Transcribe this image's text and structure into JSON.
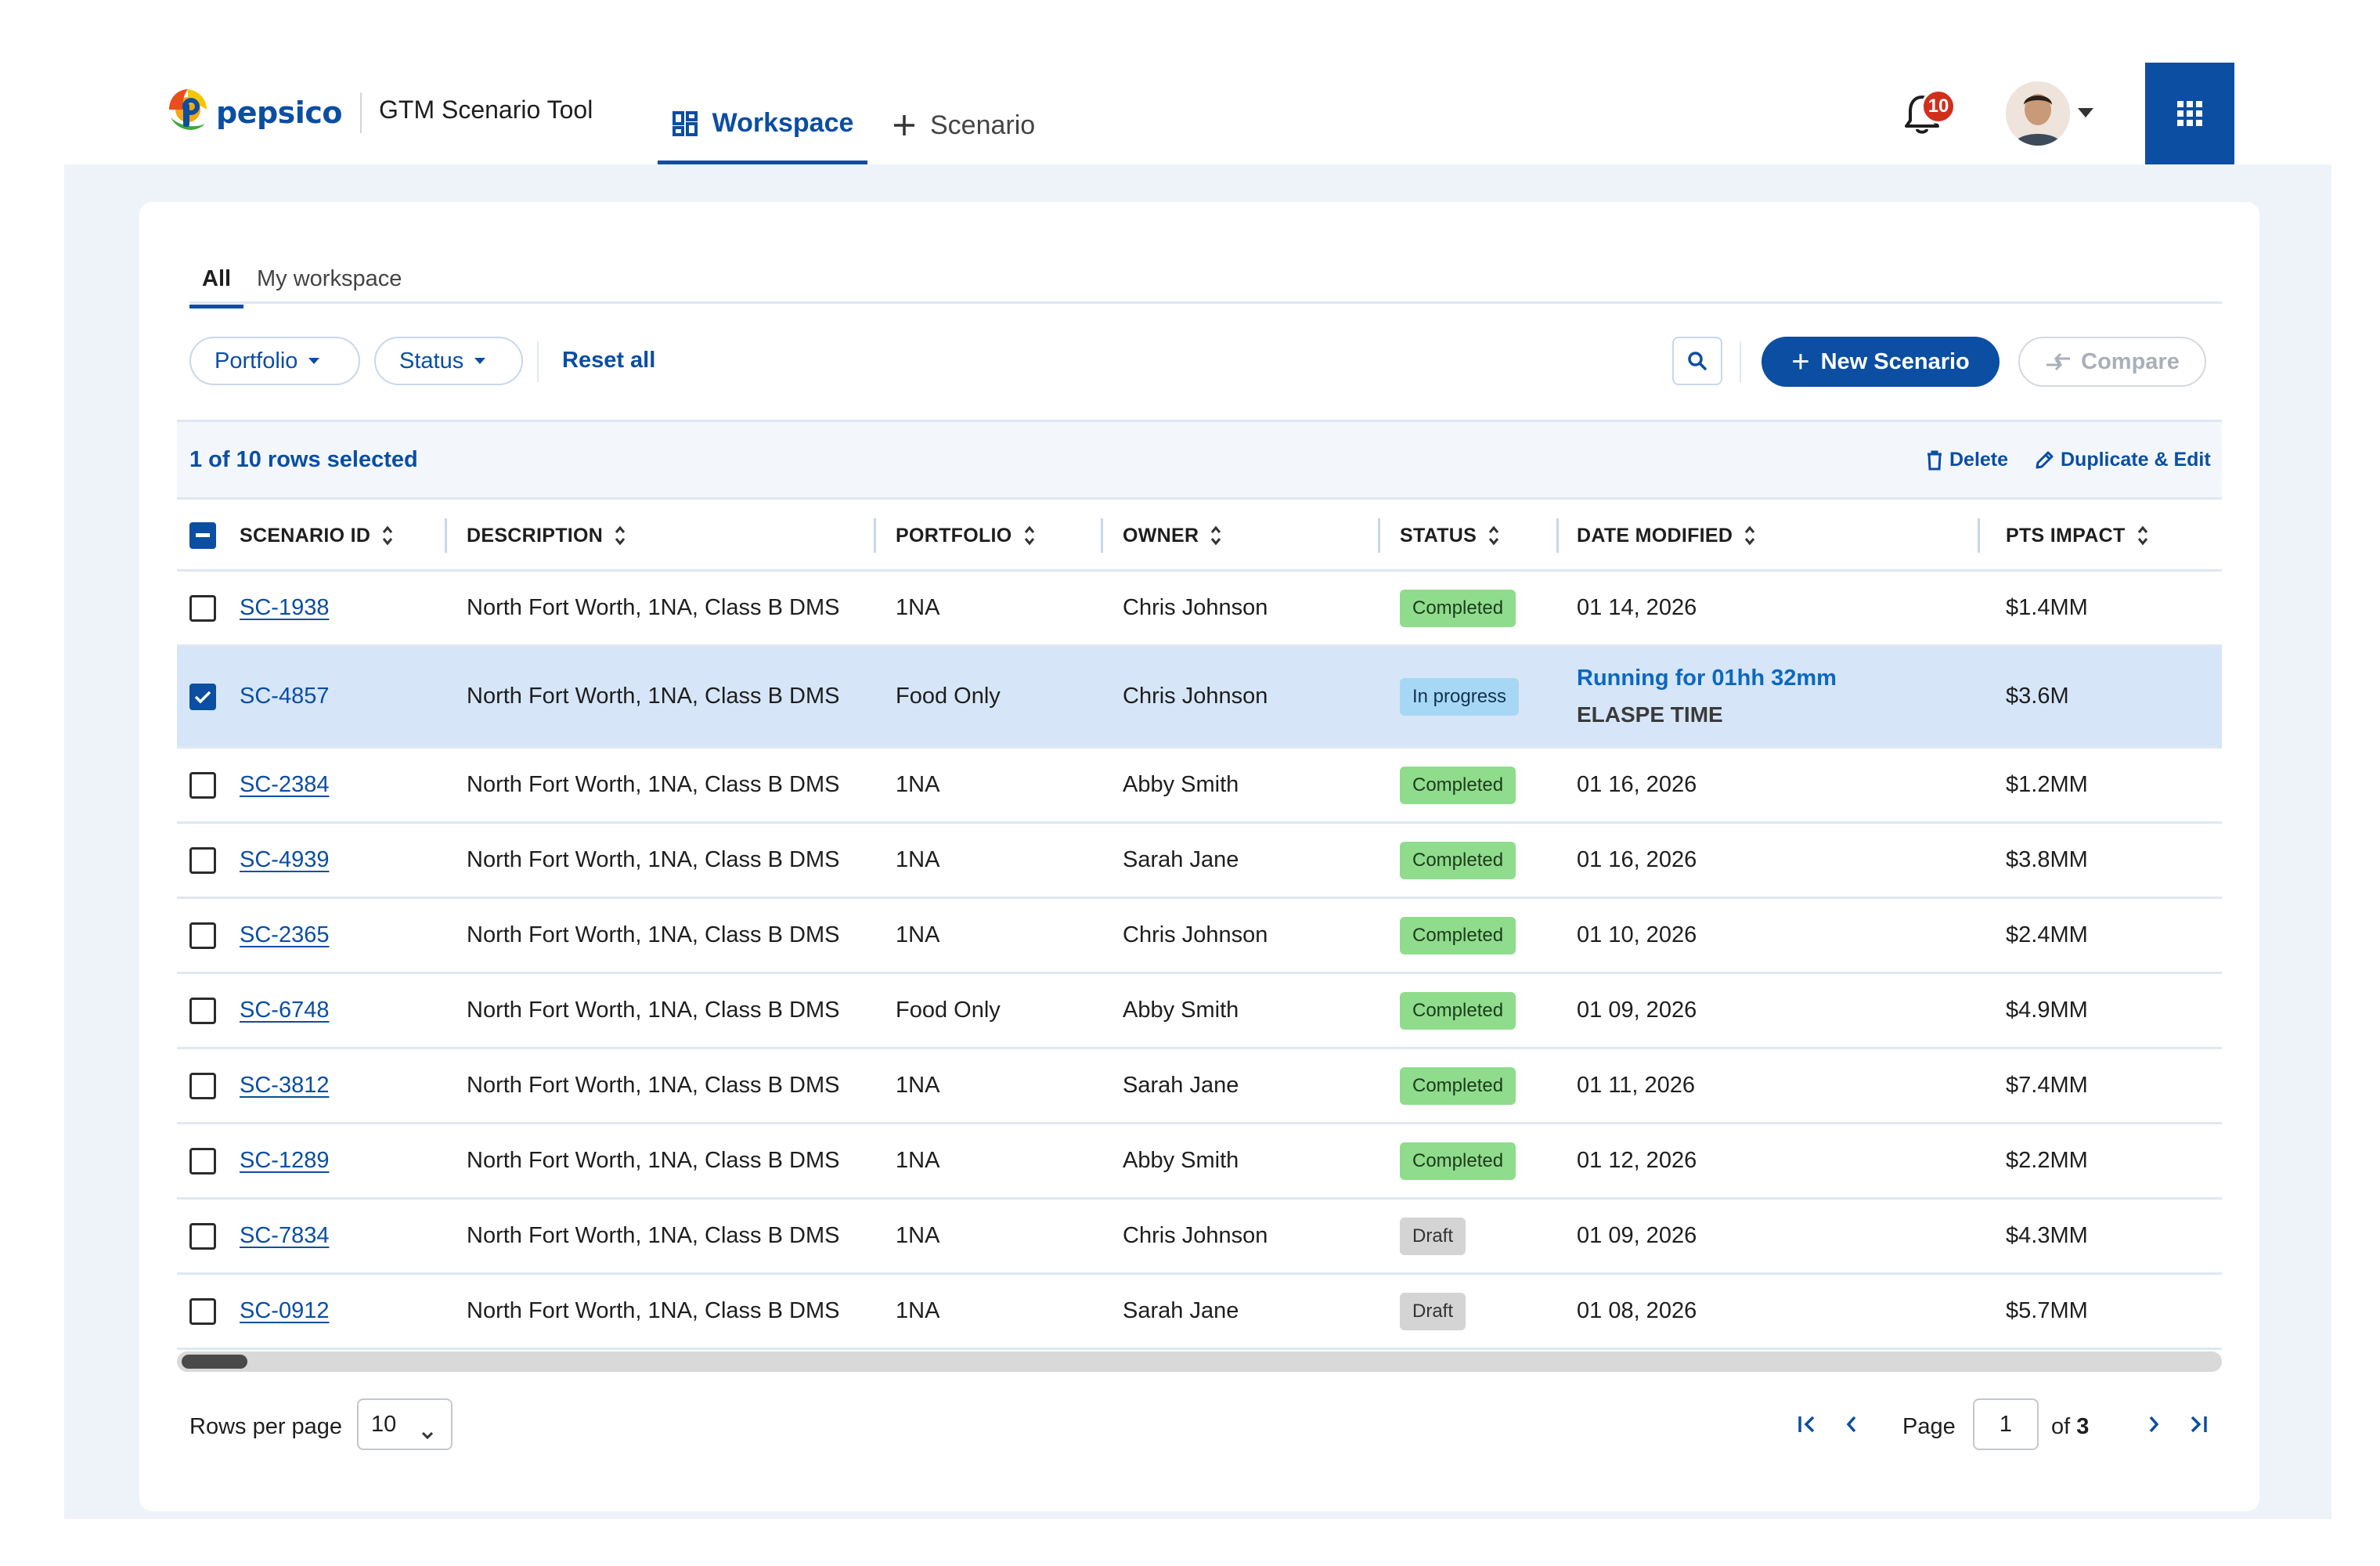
{
  "header": {
    "logo_text": "pepsico",
    "app_name": "GTM Scenario Tool",
    "nav": [
      {
        "label": "Workspace",
        "active": true,
        "icon": "dashboard-icon"
      },
      {
        "label": "Scenario",
        "active": false,
        "icon": "plus-icon"
      }
    ],
    "notifications_count": "10",
    "apps_icon": "grid-apps-icon"
  },
  "subtabs": [
    {
      "label": "All",
      "active": true
    },
    {
      "label": "My workspace",
      "active": false
    }
  ],
  "toolbar": {
    "filters": [
      "Portfolio",
      "Status"
    ],
    "reset_label": "Reset all",
    "new_label": "New Scenario",
    "compare_label": "Compare"
  },
  "selection": {
    "count_text": "1 of 10 rows selected",
    "delete_label": "Delete",
    "duplicate_label": "Duplicate & Edit"
  },
  "table": {
    "columns": [
      "SCENARIO ID",
      "DESCRIPTION",
      "PORTFOLIO",
      "OWNER",
      "STATUS",
      "DATE MODIFIED",
      "PTS IMPACT"
    ],
    "rows": [
      {
        "id": "SC-1938",
        "description": "North Fort Worth, 1NA, Class B DMS",
        "portfolio": "1NA",
        "owner": "Chris Johnson",
        "status": "Completed",
        "date": "01 14, 2026",
        "impact": "$1.4MM",
        "selected": false
      },
      {
        "id": "SC-4857",
        "description": "North Fort Worth, 1NA, Class B DMS",
        "portfolio": "Food Only",
        "owner": "Chris Johnson",
        "status": "In progress",
        "date": "Running for 01hh 32mm",
        "date_sub": "ELASPE TIME",
        "impact": "$3.6M",
        "selected": true
      },
      {
        "id": "SC-2384",
        "description": "North Fort Worth, 1NA, Class B DMS",
        "portfolio": "1NA",
        "owner": "Abby Smith",
        "status": "Completed",
        "date": "01 16, 2026",
        "impact": "$1.2MM",
        "selected": false
      },
      {
        "id": "SC-4939",
        "description": "North Fort Worth, 1NA, Class B DMS",
        "portfolio": "1NA",
        "owner": "Sarah Jane",
        "status": "Completed",
        "date": "01 16, 2026",
        "impact": "$3.8MM",
        "selected": false
      },
      {
        "id": "SC-2365",
        "description": "North Fort Worth, 1NA, Class B DMS",
        "portfolio": "1NA",
        "owner": "Chris Johnson",
        "status": "Completed",
        "date": "01 10, 2026",
        "impact": "$2.4MM",
        "selected": false
      },
      {
        "id": "SC-6748",
        "description": "North Fort Worth, 1NA, Class B DMS",
        "portfolio": "Food Only",
        "owner": "Abby Smith",
        "status": "Completed",
        "date": "01 09, 2026",
        "impact": "$4.9MM",
        "selected": false
      },
      {
        "id": "SC-3812",
        "description": "North Fort Worth, 1NA, Class B DMS",
        "portfolio": "1NA",
        "owner": "Sarah Jane",
        "status": "Completed",
        "date": "01 11, 2026",
        "impact": "$7.4MM",
        "selected": false
      },
      {
        "id": "SC-1289",
        "description": "North Fort Worth, 1NA, Class B DMS",
        "portfolio": "1NA",
        "owner": "Abby Smith",
        "status": "Completed",
        "date": "01 12, 2026",
        "impact": "$2.2MM",
        "selected": false
      },
      {
        "id": "SC-7834",
        "description": "North Fort Worth, 1NA, Class B DMS",
        "portfolio": "1NA",
        "owner": "Chris Johnson",
        "status": "Draft",
        "date": "01 09, 2026",
        "impact": "$4.3MM",
        "selected": false
      },
      {
        "id": "SC-0912",
        "description": "North Fort Worth, 1NA, Class B DMS",
        "portfolio": "1NA",
        "owner": "Sarah Jane",
        "status": "Draft",
        "date": "01 08, 2026",
        "impact": "$5.7MM",
        "selected": false
      }
    ]
  },
  "pagination": {
    "rows_per_page_label": "Rows per page",
    "rows_per_page": "10",
    "page_label": "Page",
    "current_page": "1",
    "of_label": "of",
    "total_pages": "3"
  },
  "colors": {
    "brand": "#0b4ea2",
    "completed": "#8fdc8c",
    "in_progress": "#a6d8f5",
    "draft": "#d4d4d4",
    "selected_row": "#d6e6f8",
    "badge": "#d0301a"
  }
}
